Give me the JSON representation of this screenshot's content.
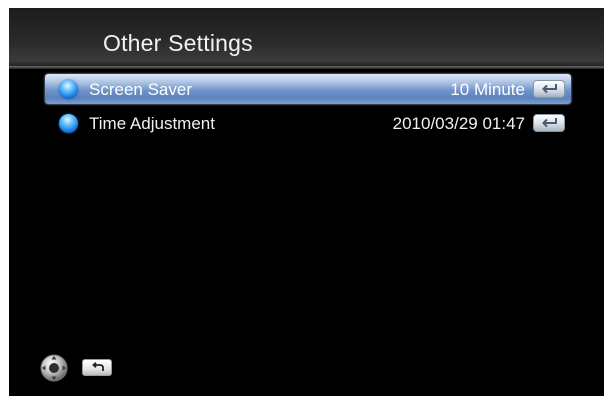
{
  "header": {
    "title": "Other Settings"
  },
  "menu": {
    "items": [
      {
        "label": "Screen Saver",
        "value": "10 Minute",
        "selected": true,
        "action_icon": "enter-icon"
      },
      {
        "label": "Time Adjustment",
        "value": "2010/03/29 01:47",
        "selected": false,
        "action_icon": "enter-icon"
      }
    ]
  },
  "footer": {
    "icons": [
      "remote-dpad-icon",
      "back-return-icon"
    ]
  },
  "colors": {
    "background": "#000000",
    "selection_highlight": "#6f93c9",
    "bullet": "#1b7fe0",
    "text": "#f0f0f0"
  }
}
